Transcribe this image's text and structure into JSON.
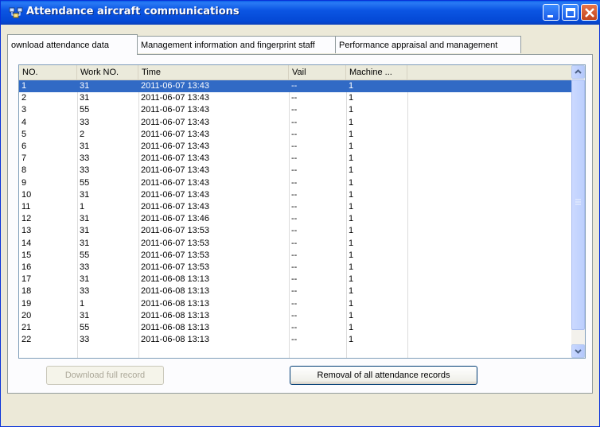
{
  "window": {
    "title": "Attendance aircraft communications"
  },
  "tabs": [
    {
      "label": "ownload attendance data"
    },
    {
      "label": "Management information and fingerprint staff"
    },
    {
      "label": "Performance appraisal and management"
    }
  ],
  "table": {
    "columns": [
      "NO.",
      "Work NO.",
      "Time",
      "Vail",
      "Machine ..."
    ],
    "rows": [
      [
        "1",
        "31",
        "2011-06-07 13:43",
        "--",
        "1"
      ],
      [
        "2",
        "31",
        "2011-06-07 13:43",
        "--",
        "1"
      ],
      [
        "3",
        "55",
        "2011-06-07 13:43",
        "--",
        "1"
      ],
      [
        "4",
        "33",
        "2011-06-07 13:43",
        "--",
        "1"
      ],
      [
        "5",
        "2",
        "2011-06-07 13:43",
        "--",
        "1"
      ],
      [
        "6",
        "31",
        "2011-06-07 13:43",
        "--",
        "1"
      ],
      [
        "7",
        "33",
        "2011-06-07 13:43",
        "--",
        "1"
      ],
      [
        "8",
        "33",
        "2011-06-07 13:43",
        "--",
        "1"
      ],
      [
        "9",
        "55",
        "2011-06-07 13:43",
        "--",
        "1"
      ],
      [
        "10",
        "31",
        "2011-06-07 13:43",
        "--",
        "1"
      ],
      [
        "11",
        "1",
        "2011-06-07 13:43",
        "--",
        "1"
      ],
      [
        "12",
        "31",
        "2011-06-07 13:46",
        "--",
        "1"
      ],
      [
        "13",
        "31",
        "2011-06-07 13:53",
        "--",
        "1"
      ],
      [
        "14",
        "31",
        "2011-06-07 13:53",
        "--",
        "1"
      ],
      [
        "15",
        "55",
        "2011-06-07 13:53",
        "--",
        "1"
      ],
      [
        "16",
        "33",
        "2011-06-07 13:53",
        "--",
        "1"
      ],
      [
        "17",
        "31",
        "2011-06-08 13:13",
        "--",
        "1"
      ],
      [
        "18",
        "33",
        "2011-06-08 13:13",
        "--",
        "1"
      ],
      [
        "19",
        "1",
        "2011-06-08 13:13",
        "--",
        "1"
      ],
      [
        "20",
        "31",
        "2011-06-08 13:13",
        "--",
        "1"
      ],
      [
        "21",
        "55",
        "2011-06-08 13:13",
        "--",
        "1"
      ],
      [
        "22",
        "33",
        "2011-06-08 13:13",
        "--",
        "1"
      ]
    ],
    "selected_row": 0
  },
  "buttons": {
    "download_full": "Download full record",
    "remove_all": "Removal of all attendance records"
  },
  "colors": {
    "title_bar": "#0b55e3",
    "selection": "#316ac5",
    "face": "#ece9d8"
  }
}
